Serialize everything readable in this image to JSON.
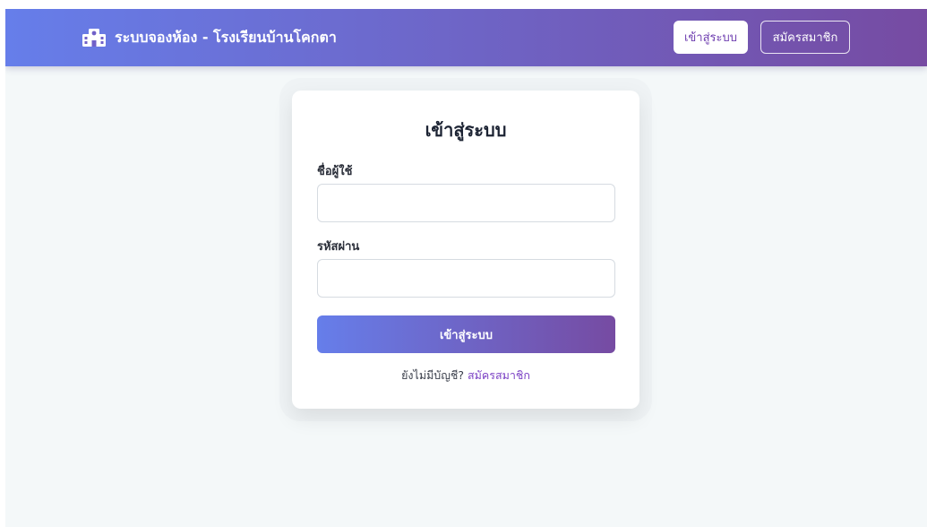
{
  "header": {
    "brand_icon": "school-icon",
    "brand_title": "ระบบจองห้อง - โรงเรียนบ้านโคกตา",
    "login_label": "เข้าสู่ระบบ",
    "register_label": "สมัครสมาชิก",
    "gradient_start": "#667eea",
    "gradient_end": "#764ba2"
  },
  "login_form": {
    "title": "เข้าสู่ระบบ",
    "username_label": "ชื่อผู้ใช้",
    "username_value": "",
    "password_label": "รหัสผ่าน",
    "password_value": "",
    "submit_label": "เข้าสู่ระบบ",
    "no_account_text": "ยังไม่มีบัญชี?",
    "register_link_label": "สมัครสมาชิก",
    "link_color": "#7a3fc4"
  }
}
